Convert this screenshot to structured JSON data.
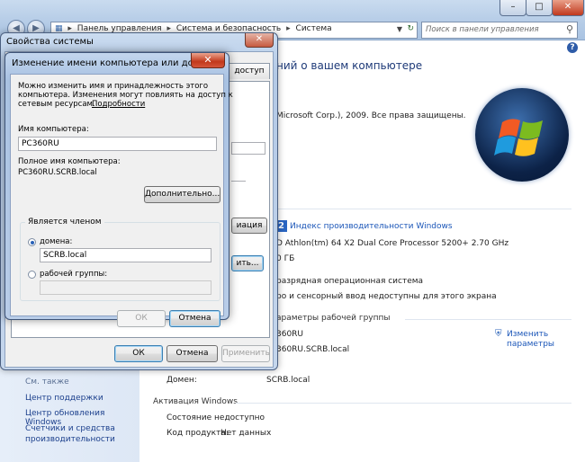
{
  "control_panel": {
    "breadcrumb": [
      "Панель управления",
      "Система и безопасность",
      "Система"
    ],
    "search_placeholder": "Поиск в панели управления",
    "heading": "ний о вашем компьютере",
    "copyright": "Microsoft Corp.), 2009. Все права защищены.",
    "rating_badge": "2",
    "rating_link": "Индекс производительности Windows",
    "processor": "D Athlon(tm) 64 X2 Dual Core Processor 5200+   2.70 GHz",
    "memory": "0 ГБ",
    "system_type": "разрядная операционная система",
    "pen_touch": "ро и сенсорный ввод недоступны для этого экрана",
    "workgroup_section": "араметры рабочей группы",
    "computer_name": "360RU",
    "full_name": "360RU.SCRB.local",
    "change_settings": [
      "Изменить",
      "параметры"
    ],
    "domain_label": "Домен:",
    "domain_value": "SCRB.local",
    "activation_section": "Активация Windows",
    "activation_status": "Состояние недоступно",
    "product_code_label": "Код продукта:",
    "product_code_value": "Нет данных",
    "see_also": "См. также",
    "left_links": [
      "Центр поддержки",
      "Центр обновления Windows",
      "Счетчики и средства",
      "производительности"
    ]
  },
  "system_properties": {
    "title": "Свойства системы",
    "tab_fragment": "доступ",
    "btn_fragment_1": "иация",
    "btn_fragment_2": "ить...",
    "ok": "ОК",
    "cancel": "Отмена",
    "apply": "Применить"
  },
  "rename_dialog": {
    "title": "Изменение имени компьютера или домена",
    "info_lines": [
      "Можно изменить имя и принадлежность этого",
      "компьютера. Изменения могут повлиять на доступ к",
      "сетевым ресурсам."
    ],
    "details_link": "Подробности",
    "computer_name_label": "Имя компьютера:",
    "computer_name_value": "PC360RU",
    "full_name_label": "Полное имя компьютера:",
    "full_name_value": "PC360RU.SCRB.local",
    "more_button": "Дополнительно...",
    "member_of": "Является членом",
    "domain_radio": "домена:",
    "domain_value": "SCRB.local",
    "workgroup_radio": "рабочей группы:",
    "workgroup_value": "",
    "ok": "ОК",
    "cancel": "Отмена"
  }
}
